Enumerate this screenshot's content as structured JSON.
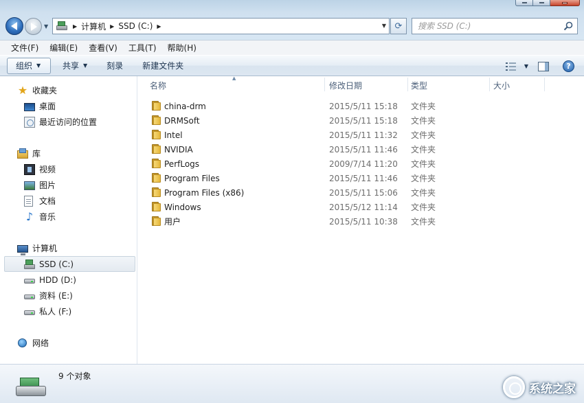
{
  "window": {
    "address": {
      "crumbs": [
        "计算机",
        "SSD (C:)"
      ]
    },
    "search": {
      "placeholder": "搜索 SSD (C:)"
    }
  },
  "menubar": [
    {
      "label": "文件(F)"
    },
    {
      "label": "编辑(E)"
    },
    {
      "label": "查看(V)"
    },
    {
      "label": "工具(T)"
    },
    {
      "label": "帮助(H)"
    }
  ],
  "toolbar": {
    "organize": "组织",
    "share": "共享",
    "burn": "刻录",
    "new_folder": "新建文件夹"
  },
  "columns": {
    "name": "名称",
    "modified": "修改日期",
    "type": "类型",
    "size": "大小"
  },
  "nav": {
    "favorites": {
      "label": "收藏夹",
      "items": [
        "桌面",
        "最近访问的位置"
      ]
    },
    "libraries": {
      "label": "库",
      "items": [
        "视频",
        "图片",
        "文档",
        "音乐"
      ]
    },
    "computer": {
      "label": "计算机",
      "items": [
        "SSD (C:)",
        "HDD (D:)",
        "资料 (E:)",
        "私人 (F:)"
      ]
    },
    "network": {
      "label": "网络"
    }
  },
  "files": [
    {
      "name": "china-drm",
      "date": "2015/5/11 15:18",
      "type": "文件夹"
    },
    {
      "name": "DRMSoft",
      "date": "2015/5/11 15:18",
      "type": "文件夹"
    },
    {
      "name": "Intel",
      "date": "2015/5/11 11:32",
      "type": "文件夹"
    },
    {
      "name": "NVIDIA",
      "date": "2015/5/11 11:46",
      "type": "文件夹"
    },
    {
      "name": "PerfLogs",
      "date": "2009/7/14 11:20",
      "type": "文件夹"
    },
    {
      "name": "Program Files",
      "date": "2015/5/11 11:46",
      "type": "文件夹"
    },
    {
      "name": "Program Files (x86)",
      "date": "2015/5/11 15:06",
      "type": "文件夹"
    },
    {
      "name": "Windows",
      "date": "2015/5/12 11:14",
      "type": "文件夹"
    },
    {
      "name": "用户",
      "date": "2015/5/11 10:38",
      "type": "文件夹"
    }
  ],
  "status": {
    "count": "9 个对象"
  },
  "watermark": {
    "text": "系统之家"
  },
  "colors": {
    "accent": "#2f6fbd",
    "folder": "#e6b83c"
  }
}
